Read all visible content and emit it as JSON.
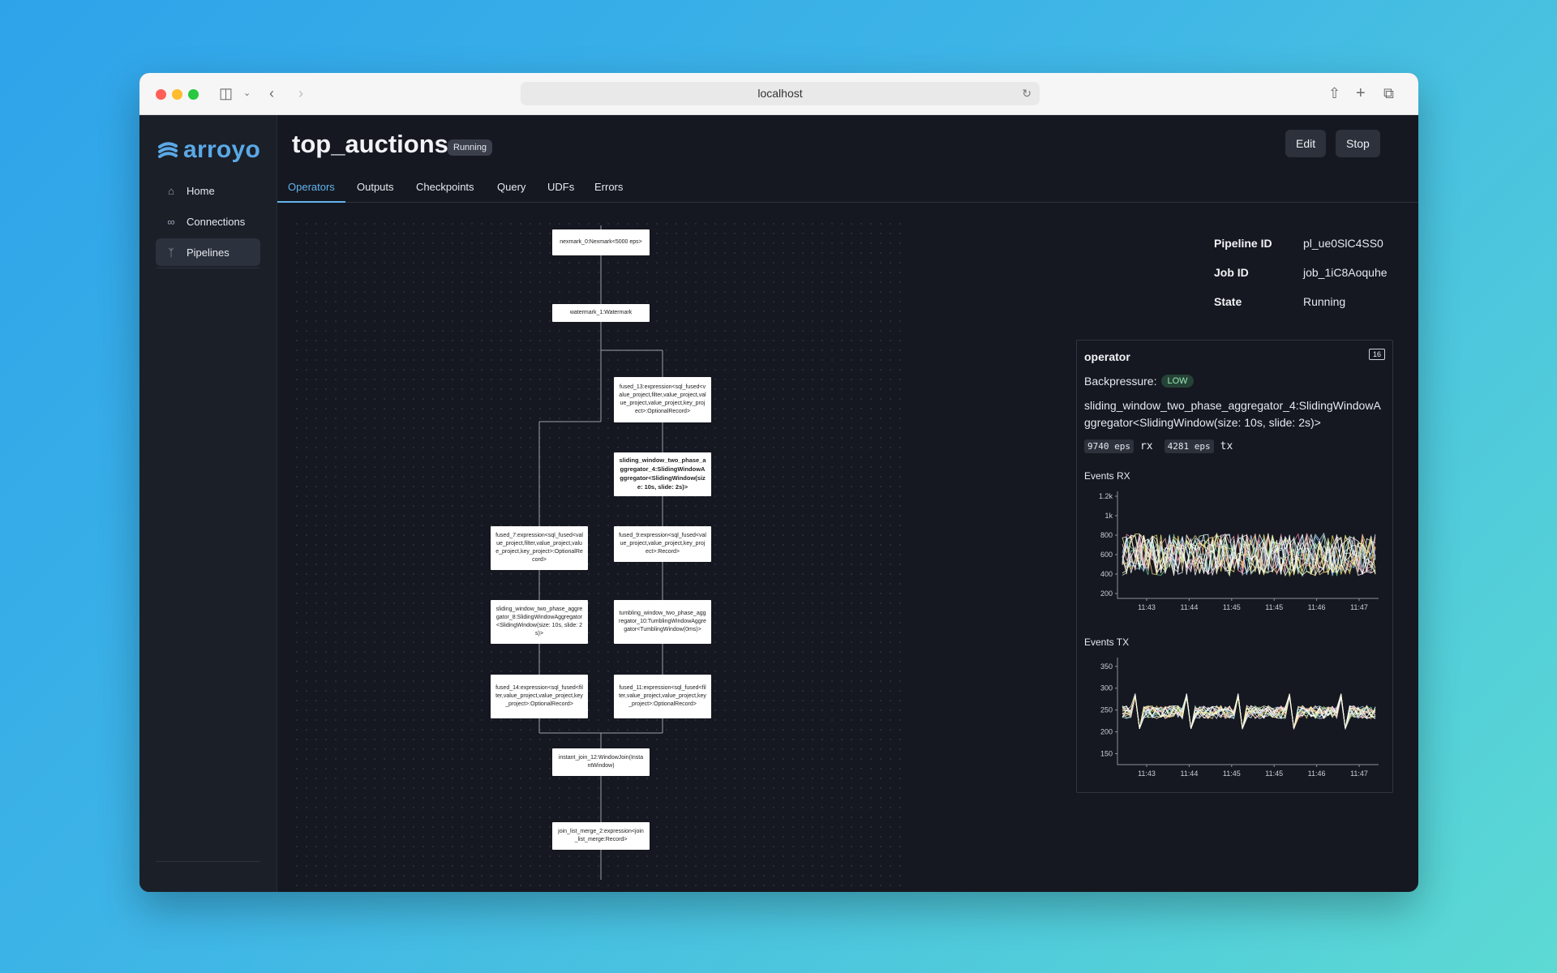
{
  "browser": {
    "url": "localhost"
  },
  "app": {
    "brand": "arroyo",
    "brand_color": "#5aa9e6",
    "nav": [
      {
        "label": "Home",
        "icon": "home-icon",
        "active": false
      },
      {
        "label": "Connections",
        "icon": "link-icon",
        "active": false
      },
      {
        "label": "Pipelines",
        "icon": "branch-icon",
        "active": true
      }
    ]
  },
  "pipeline": {
    "name": "top_auctions",
    "state_badge": "Running",
    "edit_label": "Edit",
    "stop_label": "Stop",
    "tabs": [
      "Operators",
      "Outputs",
      "Checkpoints",
      "Query",
      "UDFs",
      "Errors"
    ],
    "active_tab": "Operators"
  },
  "graph": {
    "nodes": [
      {
        "id": "n0",
        "label": "nexmark_0:Nexmark<5000 eps>"
      },
      {
        "id": "n1",
        "label": "watermark_1:Watermark"
      },
      {
        "id": "n13",
        "label": "fused_13:expression<sql_fused<value_project,filter,value_project,value_project,value_project,key_project>:OptionalRecord>"
      },
      {
        "id": "n4",
        "label": "sliding_window_two_phase_aggregator_4:SlidingWindowAggregator<SlidingWindow(size: 10s, slide: 2s)>",
        "selected": true
      },
      {
        "id": "n7",
        "label": "fused_7:expression<sql_fused<value_project,filter,value_project,value_project,key_project>:OptionalRecord>"
      },
      {
        "id": "n9",
        "label": "fused_9:expression<sql_fused<value_project,value_project,key_project>:Record>"
      },
      {
        "id": "n8",
        "label": "sliding_window_two_phase_aggregator_8:SlidingWindowAggregator<SlidingWindow(size: 10s, slide: 2s)>"
      },
      {
        "id": "n10",
        "label": "tumbling_window_two_phase_aggregator_10:TumblingWindowAggregator<TumblingWindow(0ms)>"
      },
      {
        "id": "n14",
        "label": "fused_14:expression<sql_fused<filter,value_project,value_project,key_project>:OptionalRecord>"
      },
      {
        "id": "n11",
        "label": "fused_11:expression<sql_fused<filter,value_project,value_project,key_project>:OptionalRecord>"
      },
      {
        "id": "n12",
        "label": "instant_join_12:WindowJoin(InstantWindow)"
      },
      {
        "id": "n2",
        "label": "join_list_merge_2:expression<join_list_merge:Record>"
      }
    ]
  },
  "details": {
    "pipeline_id_label": "Pipeline ID",
    "pipeline_id": "pl_ue0SlC4SS0",
    "job_id_label": "Job ID",
    "job_id": "job_1iC8Aoquhe",
    "state_label": "State",
    "state": "Running"
  },
  "operator": {
    "title": "operator",
    "parallelism": "16",
    "backpressure_label": "Backpressure:",
    "backpressure": "LOW",
    "backpressure_color": "#9ae6b4",
    "description": "sliding_window_two_phase_aggregator_4:SlidingWindowAggregator<SlidingWindow(size: 10s, slide: 2s)>",
    "rx_rate": "9740 eps",
    "rx_label": "rx",
    "tx_rate": "4281 eps",
    "tx_label": "tx"
  },
  "chart_data": [
    {
      "type": "line",
      "title": "Events RX",
      "x_ticks": [
        "11:43",
        "11:44",
        "11:45",
        "11:45",
        "11:46",
        "11:47"
      ],
      "y_ticks": [
        "1.2k",
        "1k",
        "800",
        "600",
        "400",
        "200"
      ],
      "ylim": [
        150,
        1250
      ],
      "series_count": 16,
      "base": 600,
      "amplitude": 220,
      "points": 60
    },
    {
      "type": "line",
      "title": "Events TX",
      "x_ticks": [
        "11:43",
        "11:44",
        "11:45",
        "11:45",
        "11:46",
        "11:47"
      ],
      "y_ticks": [
        "350",
        "300",
        "250",
        "200",
        "150"
      ],
      "ylim": [
        125,
        370
      ],
      "series_count": 16,
      "base": 245,
      "amplitude": 15,
      "points": 60
    }
  ]
}
